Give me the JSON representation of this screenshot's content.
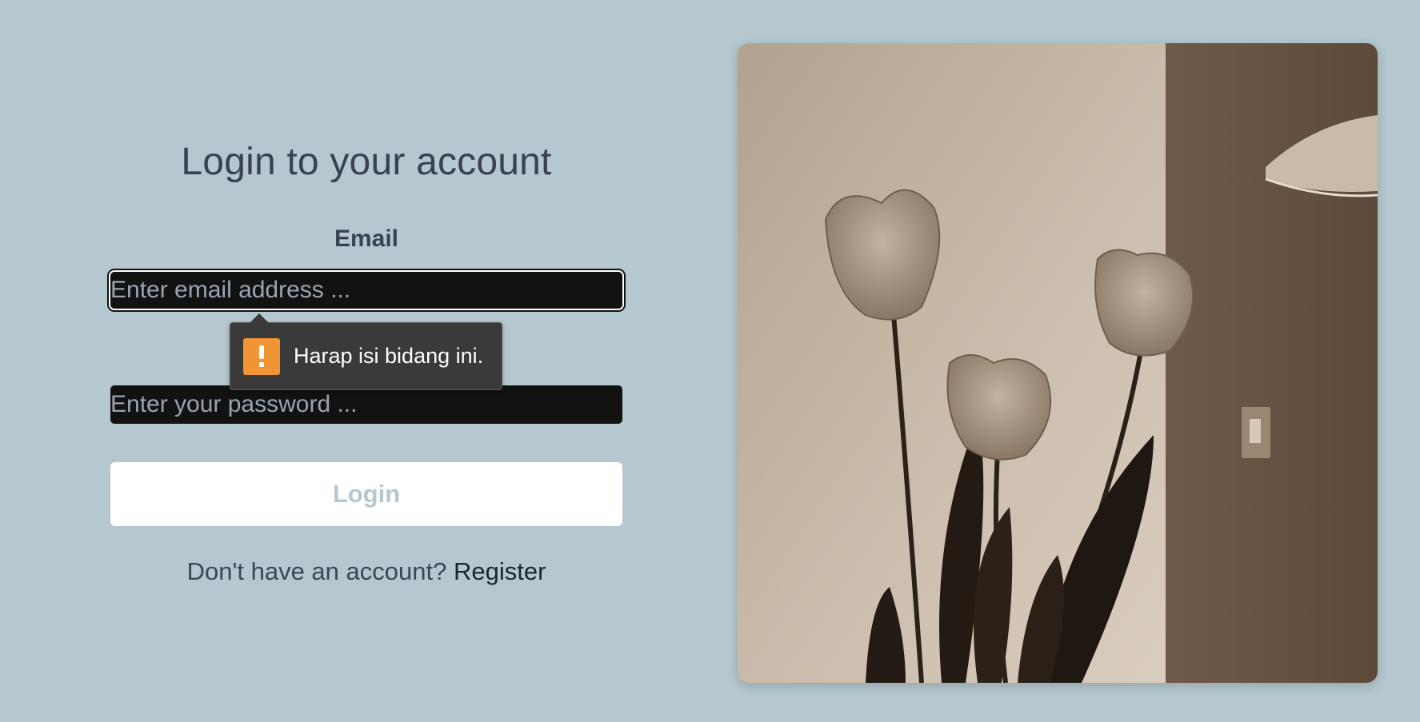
{
  "login": {
    "title": "Login to your account",
    "email_label": "Email",
    "email_placeholder": "Enter email address ...",
    "password_placeholder": "Enter your password ...",
    "login_button": "Login",
    "register_prompt": "Don't have an account?",
    "register_link": "Register"
  },
  "validation_tooltip": {
    "message": "Harap isi bidang ini.",
    "icon": "warning-icon"
  },
  "colors": {
    "background": "#b5c7cf",
    "input_bg": "#121212",
    "warning": "#f19433"
  },
  "hero_image": {
    "subject": "tulip-flowers-photo"
  }
}
